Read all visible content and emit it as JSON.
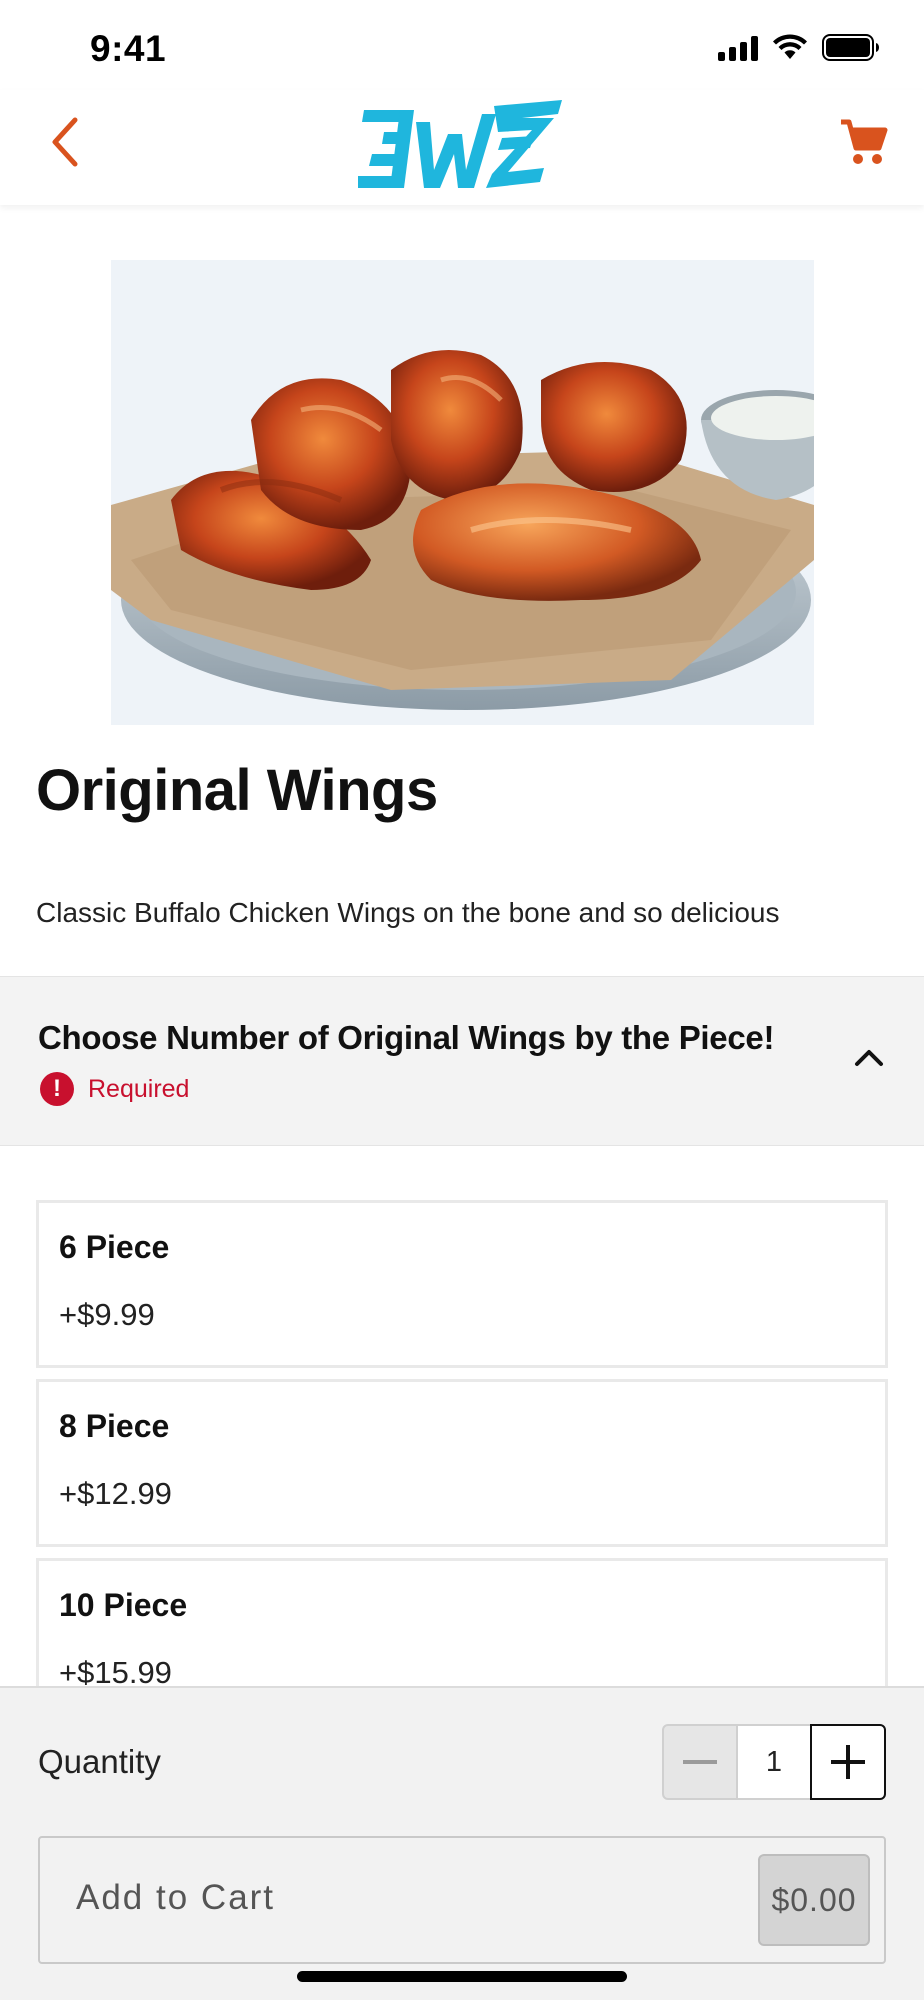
{
  "status_bar": {
    "time": "9:41"
  },
  "nav": {
    "logo_text": "EWZ",
    "back_icon": "chevron-left-icon",
    "cart_icon": "shopping-cart-icon"
  },
  "colors": {
    "accent": "#d9531e",
    "logo": "#1fb6dd",
    "required": "#c8102e"
  },
  "product": {
    "title": "Original Wings",
    "description": "Classic Buffalo Chicken Wings on the bone and so delicious"
  },
  "option_group": {
    "title": "Choose Number of Original Wings by the Piece!",
    "required_label": "Required",
    "options": [
      {
        "name": "6 Piece",
        "price": "+$9.99"
      },
      {
        "name": "8 Piece",
        "price": "+$12.99"
      },
      {
        "name": "10 Piece",
        "price": "+$15.99"
      }
    ]
  },
  "footer": {
    "quantity_label": "Quantity",
    "quantity_value": "1",
    "add_to_cart_label": "Add to Cart",
    "total_price": "$0.00"
  }
}
